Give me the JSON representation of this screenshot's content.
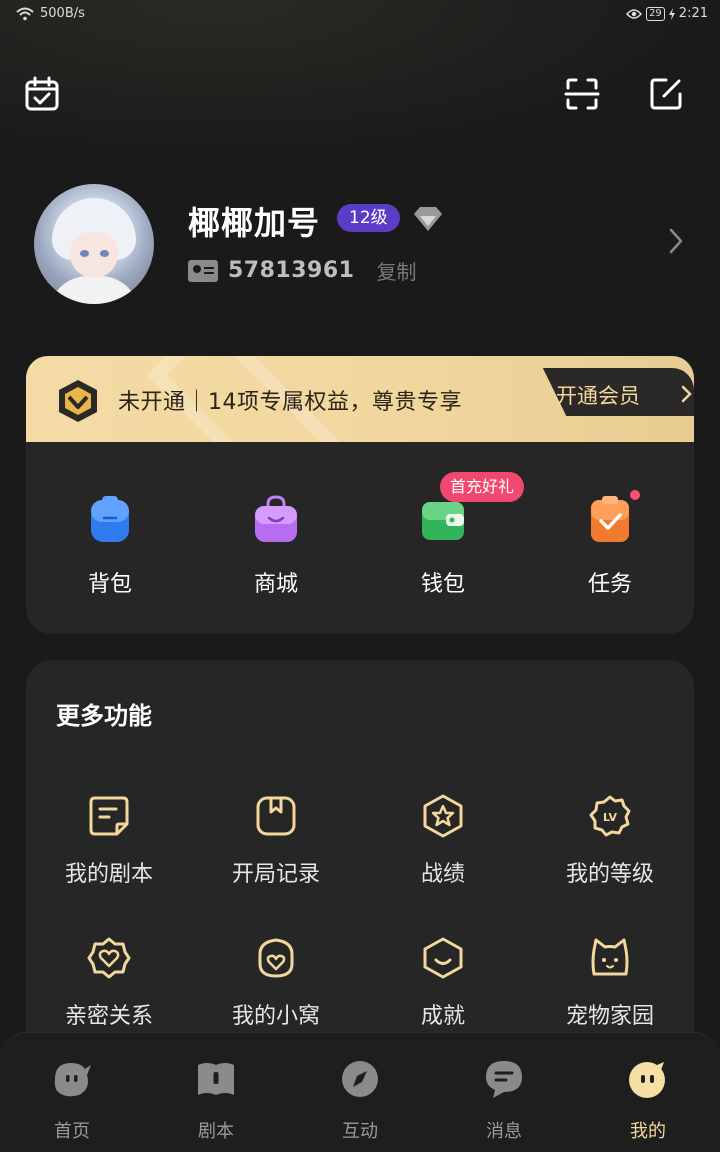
{
  "status_bar": {
    "network_speed": "500B/s",
    "battery": "29",
    "time": "2:21"
  },
  "header": {
    "calendar_icon": "calendar-check-icon",
    "scan_icon": "scan-icon",
    "edit_icon": "edit-icon"
  },
  "profile": {
    "name": "椰椰加号",
    "level": "12级",
    "uid": "57813961",
    "copy_label": "复制"
  },
  "vip": {
    "text": "未开通｜14项专属权益，尊贵专享",
    "button_label": "开通会员"
  },
  "quick": {
    "items": [
      {
        "label": "背包",
        "icon": "backpack-icon"
      },
      {
        "label": "商城",
        "icon": "shopping-bag-icon"
      },
      {
        "label": "钱包",
        "icon": "wallet-icon"
      },
      {
        "label": "任务",
        "icon": "task-clipboard-icon"
      }
    ],
    "promo_badge": "首充好礼"
  },
  "more": {
    "title": "更多功能",
    "items": [
      {
        "label": "我的剧本"
      },
      {
        "label": "开局记录"
      },
      {
        "label": "战绩"
      },
      {
        "label": "我的等级"
      },
      {
        "label": "亲密关系"
      },
      {
        "label": "我的小窝"
      },
      {
        "label": "成就"
      },
      {
        "label": "宠物家园"
      }
    ]
  },
  "nav": {
    "items": [
      {
        "label": "首页"
      },
      {
        "label": "剧本"
      },
      {
        "label": "互动"
      },
      {
        "label": "消息"
      },
      {
        "label": "我的"
      }
    ],
    "active_index": 4
  },
  "colors": {
    "accent_gold": "#f3d79c",
    "level_purple": "#5b3cc4",
    "promo_red": "#f0486e"
  }
}
